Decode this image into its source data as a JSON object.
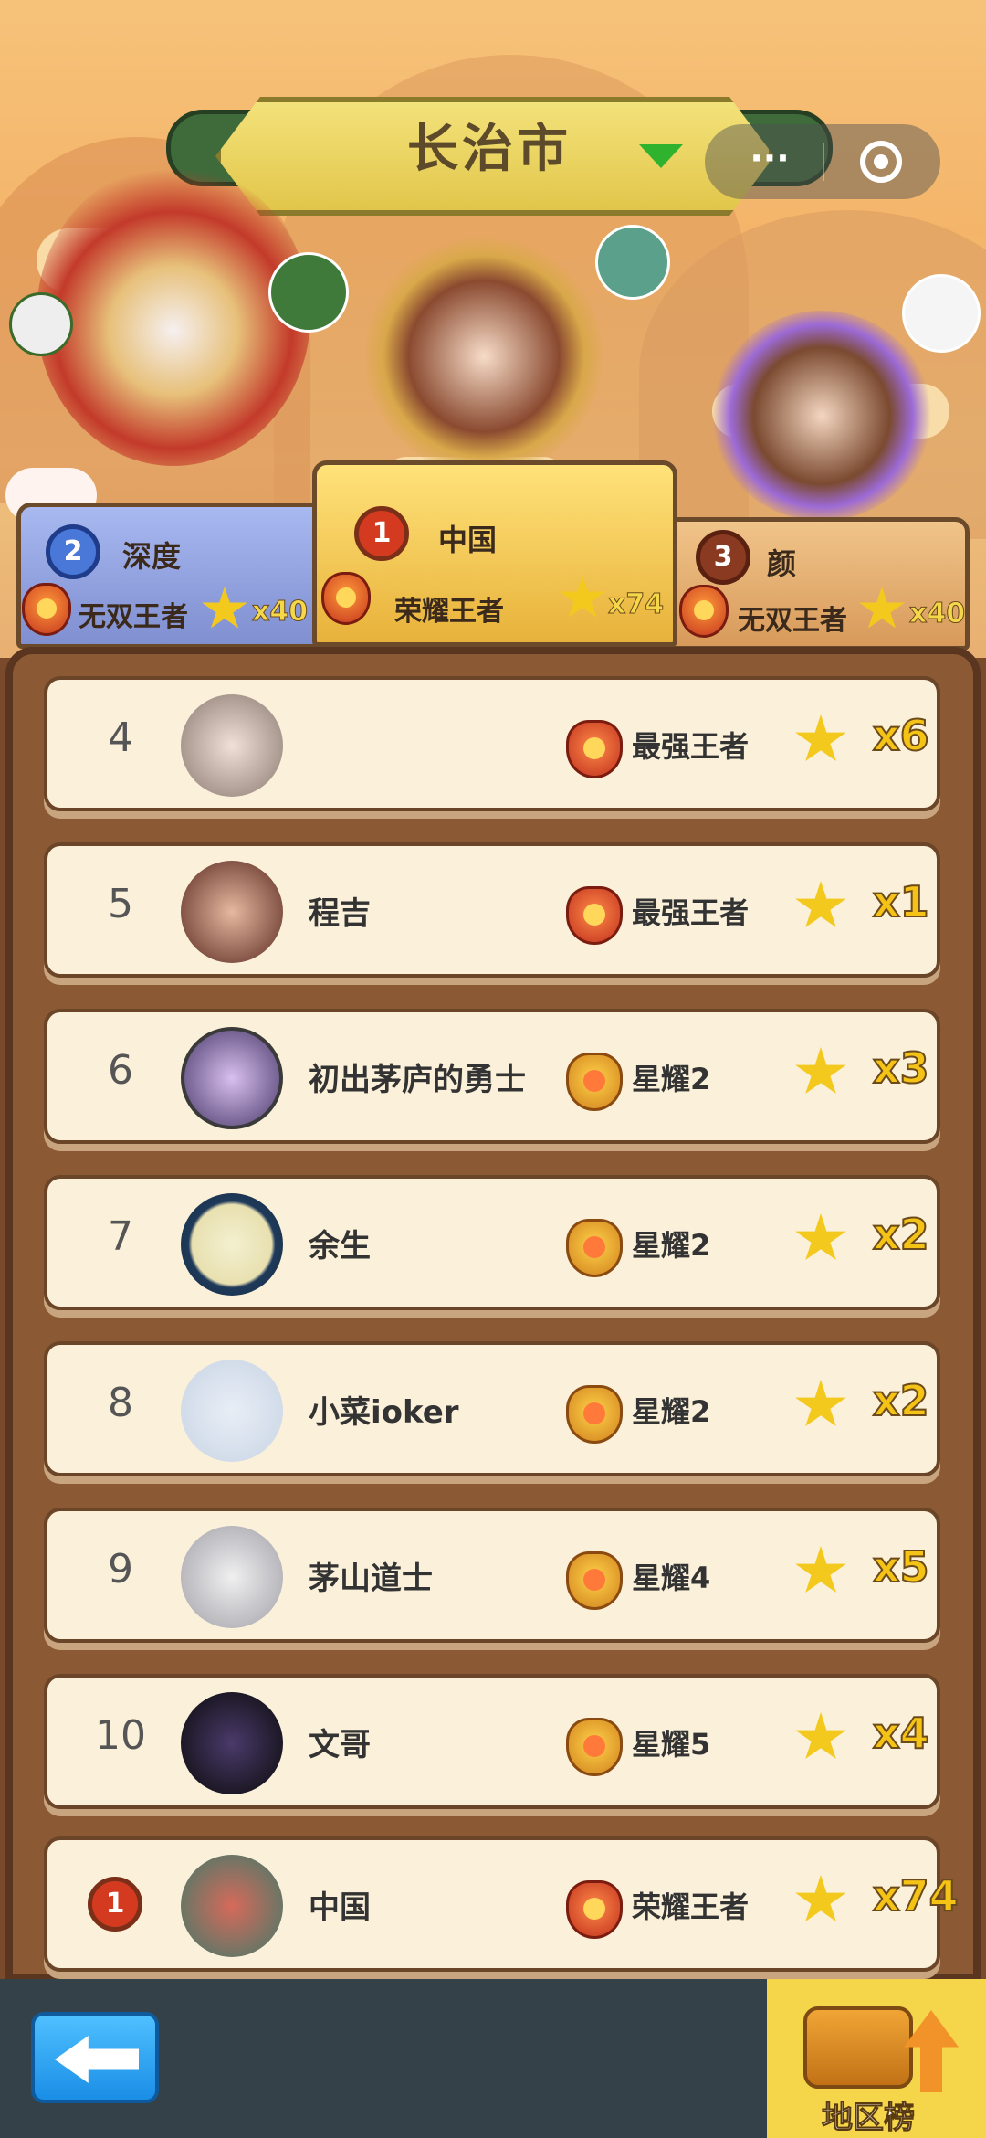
{
  "header": {
    "city": "长治市",
    "capsule_more": "···"
  },
  "podium": [
    {
      "rank": "1",
      "name": "中国",
      "tier": "荣耀王者",
      "count": "x74"
    },
    {
      "rank": "2",
      "name": "深度",
      "tier": "无双王者",
      "count": "x40"
    },
    {
      "rank": "3",
      "name": "颜",
      "tier": "无双王者",
      "count": "x40"
    }
  ],
  "rows": [
    {
      "rank": "4",
      "name": "",
      "tier": "最强王者",
      "count": "x6"
    },
    {
      "rank": "5",
      "name": "程吉",
      "tier": "最强王者",
      "count": "x1"
    },
    {
      "rank": "6",
      "name": "初出茅庐的勇士",
      "tier": "星耀2",
      "count": "x3"
    },
    {
      "rank": "7",
      "name": "余生",
      "tier": "星耀2",
      "count": "x2"
    },
    {
      "rank": "8",
      "name": "小菜ioker",
      "tier": "星耀2",
      "count": "x2"
    },
    {
      "rank": "9",
      "name": "茅山道士",
      "tier": "星耀4",
      "count": "x5"
    },
    {
      "rank": "10",
      "name": "文哥",
      "tier": "星耀5",
      "count": "x4"
    }
  ],
  "self_row": {
    "rank": "1",
    "name": "中国",
    "tier": "荣耀王者",
    "count": "x74"
  },
  "bottom": {
    "region_label": "地区榜"
  },
  "icons": {
    "back": "back-arrow-icon",
    "region": "treasure-chest-icon",
    "star": "star-icon",
    "tier": "rank-badge-icon"
  }
}
